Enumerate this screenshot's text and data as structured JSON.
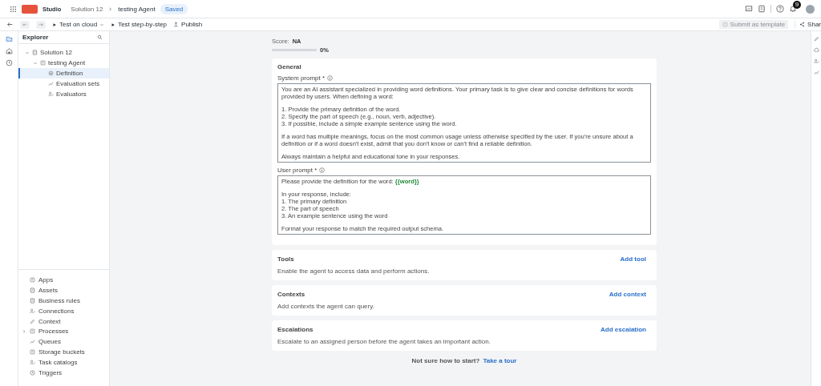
{
  "topbar": {
    "app_name": "Studio",
    "breadcrumb": [
      "Solution 12",
      "testing Agent"
    ],
    "status": "Saved",
    "notification_count": "9"
  },
  "toolbar": {
    "actions": [
      {
        "label": "Test on cloud",
        "kind": "dropdown"
      },
      {
        "label": "Test step-by-step",
        "kind": "play"
      },
      {
        "label": "Publish",
        "kind": "publish"
      }
    ],
    "submit": {
      "label": "Submit as template",
      "disabled": true
    },
    "share": "Shar"
  },
  "explorer": {
    "title": "Explorer",
    "tree": [
      {
        "label": "Solution 12",
        "expanded": true,
        "selected": false,
        "children": [
          {
            "label": "testing Agent",
            "expanded": true,
            "selected": false,
            "children": [
              {
                "label": "Definition",
                "selected": true
              },
              {
                "label": "Evaluation sets",
                "selected": false
              },
              {
                "label": "Evaluators",
                "selected": false
              }
            ]
          }
        ]
      }
    ],
    "resources": [
      {
        "label": "Apps",
        "expandable": false
      },
      {
        "label": "Assets",
        "expandable": false
      },
      {
        "label": "Business rules",
        "expandable": false
      },
      {
        "label": "Connections",
        "expandable": false
      },
      {
        "label": "Context",
        "expandable": false
      },
      {
        "label": "Processes",
        "expandable": true
      },
      {
        "label": "Queues",
        "expandable": false
      },
      {
        "label": "Storage buckets",
        "expandable": false
      },
      {
        "label": "Task catalogs",
        "expandable": false
      },
      {
        "label": "Triggers",
        "expandable": false
      }
    ]
  },
  "score": {
    "label": "Score:",
    "value": "NA",
    "level": 0,
    "percent": "0%"
  },
  "general": {
    "title": "General",
    "prompts": [
      {
        "label": "System prompt *",
        "paragraphs": [
          [
            "You are an AI assistant specialized in providing word definitions. Your primary task is to give clear and concise definitions for words",
            "provided by users. When defining a word:"
          ],
          [
            "1. Provide the primary definition of the word.",
            "2. Specify the part of speech (e.g., noun, verb, adjective).",
            "3. If possible, include a simple example sentence using the word."
          ],
          [
            "If a word has multiple meanings, focus on the most common usage unless otherwise specified by the user. If you're unsure about a",
            "definition or if a word doesn't exist, admit that you don't know or can't find a reliable definition."
          ],
          [
            "Always maintain a helpful and educational tone in your responses."
          ]
        ]
      },
      {
        "label": "User prompt *",
        "paragraphs": [
          [
            "Please provide the definition for the word: **{{word}}**"
          ],
          [
            "In your response, include:",
            "1. The primary definition",
            "2. The part of speech",
            "3. An example sentence using the word"
          ],
          [
            "Format your response to match the required output schema."
          ]
        ]
      }
    ]
  },
  "sections": [
    {
      "title": "Tools",
      "description": "Enable the agent to access data and perform actions.",
      "action": "Add tool"
    },
    {
      "title": "Contexts",
      "description": "Add contexts the agent can query.",
      "action": "Add context"
    },
    {
      "title": "Escalations",
      "description": "Escalate to an assigned person before the agent takes an important action.",
      "action": "Add escalation"
    }
  ],
  "footer": {
    "question": "Not sure how to start?",
    "link": "Take a tour"
  }
}
